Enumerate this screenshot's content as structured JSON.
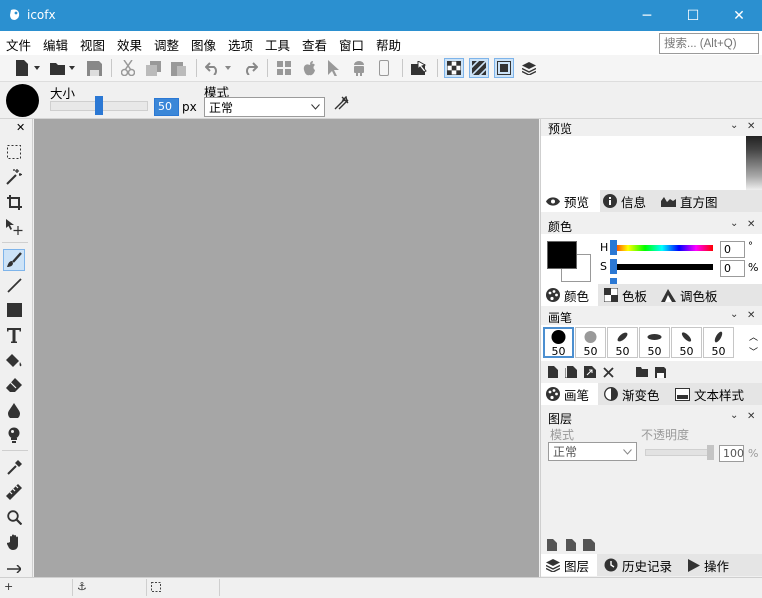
{
  "window": {
    "title": "icofx",
    "controls": {
      "minimize": "─",
      "maximize": "☐",
      "close": "✕"
    }
  },
  "menu": [
    "文件",
    "编辑",
    "视图",
    "效果",
    "调整",
    "图像",
    "选项",
    "工具",
    "查看",
    "窗口",
    "帮助"
  ],
  "search": {
    "placeholder": "搜索... (Alt+Q)"
  },
  "options": {
    "size_label": "大小",
    "size_value": "50",
    "size_unit": "px",
    "size_slider": 0.5,
    "mode_label": "模式",
    "mode_value": "正常"
  },
  "preview_panel": {
    "title": "预览",
    "tabs": [
      "预览",
      "信息",
      "直方图"
    ]
  },
  "color_panel": {
    "title": "颜色",
    "current_color": "#000000",
    "h_label": "H",
    "h_value": "0",
    "h_unit": "°",
    "s_label": "S",
    "s_value": "0",
    "s_unit": "%",
    "tabs": [
      "颜色",
      "色板",
      "调色板"
    ]
  },
  "brush_panel": {
    "title": "画笔",
    "brush_sizes": [
      "50",
      "50",
      "50",
      "50",
      "50",
      "50"
    ],
    "tabs": [
      "画笔",
      "渐变色",
      "文本样式"
    ]
  },
  "layers_panel": {
    "title": "图层",
    "mode_label": "模式",
    "mode_value": "正常",
    "opacity_label": "不透明度",
    "opacity_value": "100",
    "opacity_unit": "%",
    "tabs": [
      "图层",
      "历史记录",
      "操作"
    ]
  },
  "colors": {
    "titlebar": "#2b90d0",
    "canvas": "#a6a6a6",
    "accent": "#2b78d4"
  }
}
